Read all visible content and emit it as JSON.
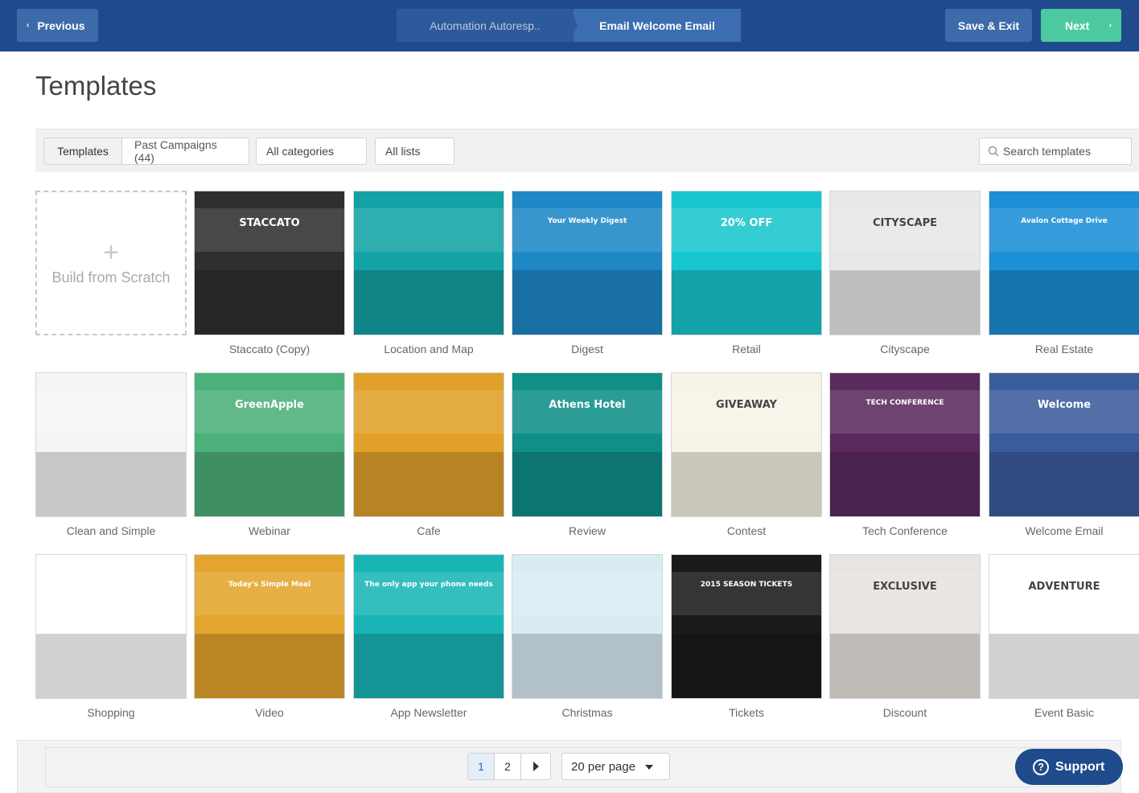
{
  "header": {
    "previous_label": "Previous",
    "breadcrumbs": [
      "Automation Autoresp..",
      "Email Welcome Email"
    ],
    "save_exit_label": "Save & Exit",
    "next_label": "Next"
  },
  "page_title": "Templates",
  "filters": {
    "tabs": [
      "Templates",
      "Past Campaigns (44)"
    ],
    "categories_value": "All categories",
    "lists_value": "All lists",
    "search_placeholder": "Search templates"
  },
  "build_from_scratch": "Build from Scratch",
  "templates": [
    {
      "name": "Staccato (Copy)",
      "thumb_text": "STACCATO",
      "bg": "#2f2f2f"
    },
    {
      "name": "Location and Map",
      "thumb_text": "",
      "bg": "#13a3a6"
    },
    {
      "name": "Digest",
      "thumb_text": "Your Weekly Digest",
      "bg": "#1e88c7"
    },
    {
      "name": "Retail",
      "thumb_text": "20% OFF",
      "bg": "#18c6cf"
    },
    {
      "name": "Cityscape",
      "thumb_text": "CITYSCAPE",
      "bg": "#e8e8e8"
    },
    {
      "name": "Real Estate",
      "thumb_text": "Avalon Cottage Drive",
      "bg": "#1c8fd6"
    },
    {
      "name": "Clean and Simple",
      "thumb_text": "",
      "bg": "#f5f5f5"
    },
    {
      "name": "Webinar",
      "thumb_text": "GreenApple",
      "bg": "#4cb07a"
    },
    {
      "name": "Cafe",
      "thumb_text": "",
      "bg": "#e1a02a"
    },
    {
      "name": "Review",
      "thumb_text": "Athens Hotel",
      "bg": "#0f8f88"
    },
    {
      "name": "Contest",
      "thumb_text": "GIVEAWAY",
      "bg": "#f7f3e6"
    },
    {
      "name": "Tech Conference",
      "thumb_text": "TECH CONFERENCE",
      "bg": "#5a2a5e"
    },
    {
      "name": "Welcome Email",
      "thumb_text": "Welcome",
      "bg": "#3b5c9c"
    },
    {
      "name": "Shopping",
      "thumb_text": "",
      "bg": "#ffffff"
    },
    {
      "name": "Video",
      "thumb_text": "Today's Simple Meal",
      "bg": "#e3a52d"
    },
    {
      "name": "App Newsletter",
      "thumb_text": "The only app your phone needs",
      "bg": "#19b5b5"
    },
    {
      "name": "Christmas",
      "thumb_text": "",
      "bg": "#d9ecf4"
    },
    {
      "name": "Tickets",
      "thumb_text": "2015 SEASON TICKETS",
      "bg": "#1a1a1a"
    },
    {
      "name": "Discount",
      "thumb_text": "EXCLUSIVE",
      "bg": "#e8e4df"
    },
    {
      "name": "Event Basic",
      "thumb_text": "ADVENTURE",
      "bg": "#ffffff"
    }
  ],
  "pagination": {
    "pages": [
      "1",
      "2"
    ],
    "current": "1",
    "per_page": "20 per page"
  },
  "support_label": "Support",
  "colors": {
    "header_bg": "#1f4b8c",
    "next_green": "#4cc9a0",
    "support_bg": "#1f4b8c"
  }
}
